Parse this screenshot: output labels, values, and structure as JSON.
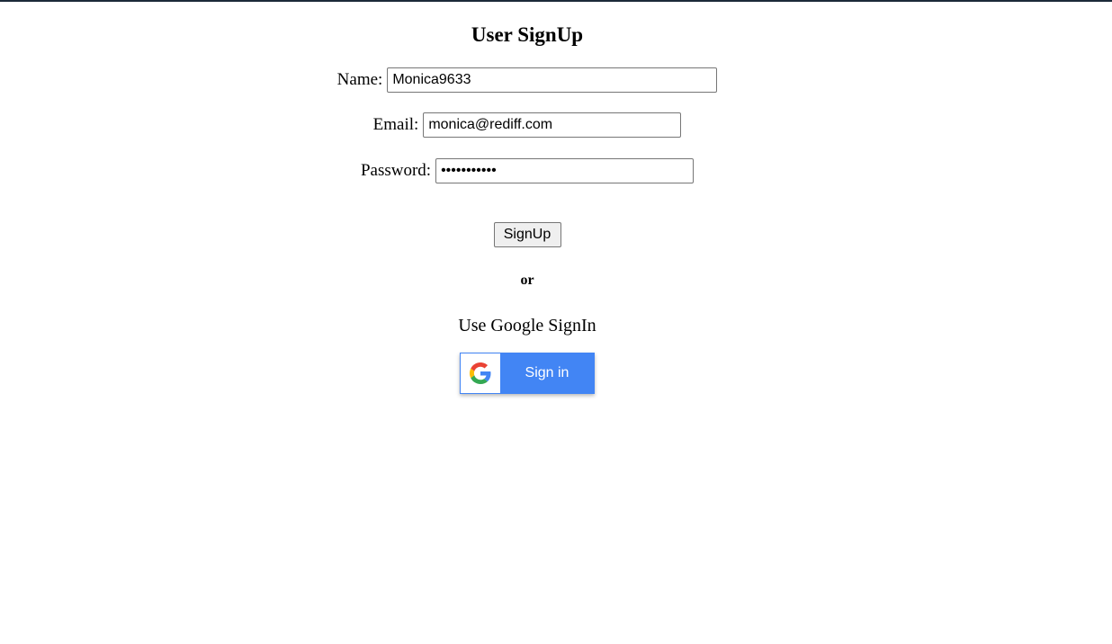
{
  "form": {
    "title": "User SignUp",
    "name_label": "Name:",
    "name_value": "Monica9633",
    "email_label": "Email:",
    "email_value": "monica@rediff.com",
    "password_label": "Password:",
    "password_value": "•••••••••••",
    "signup_label": "SignUp"
  },
  "alt": {
    "or_text": "or",
    "google_text": "Use Google SignIn",
    "google_button_label": "Sign in",
    "google_icon": "google-g-icon"
  },
  "colors": {
    "google_blue": "#4285f4",
    "top_border": "#1b2a38"
  }
}
